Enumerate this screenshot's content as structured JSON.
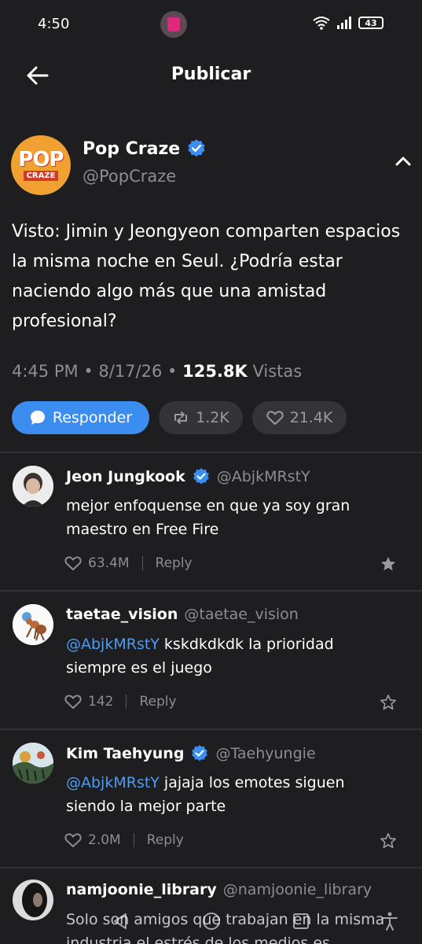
{
  "status": {
    "time": "4:50",
    "battery": "43"
  },
  "header": {
    "title": "Publicar"
  },
  "post": {
    "author": {
      "name": "Pop Craze",
      "handle": "@PopCraze",
      "logo_top": "POP",
      "logo_bottom": "CRAZE"
    },
    "text": "Visto: Jimin y Jeongyeon comparten espacios la misma noche en Seul. ¿Podría estar naciendo algo más que una amistad profesional?",
    "time": "4:45 PM",
    "date": "8/17/26",
    "views": "125.8K",
    "views_label": "Vistas",
    "reply_label": "Responder",
    "retweets": "1.2K",
    "likes": "21.4K"
  },
  "comments": [
    {
      "name": "Jeon Jungkook",
      "verified": true,
      "handle": "@AbjkMRstY",
      "mention": "",
      "text": "mejor enfoquense en que ya soy gran maestro en Free Fire",
      "likes": "63.4M",
      "reply_label": "Reply",
      "starred": true
    },
    {
      "name": "taetae_vision",
      "verified": false,
      "handle": "@taetae_vision",
      "mention": "@AbjkMRstY",
      "text": " kskdkdkdk la prioridad siempre es el juego",
      "likes": "142",
      "reply_label": "Reply",
      "starred": false
    },
    {
      "name": "Kim Taehyung",
      "verified": true,
      "handle": "@Taehyungie",
      "mention": "@AbjkMRstY",
      "text": " jajaja los emotes siguen siendo la mejor parte",
      "likes": "2.0M",
      "reply_label": "Reply",
      "starred": false
    },
    {
      "name": "namjoonie_library",
      "verified": false,
      "handle": "@namjoonie_library",
      "mention": "",
      "text": "Solo son amigos que trabajan en la misma industria el estrés de los medios es",
      "likes": "",
      "reply_label": "",
      "starred": false
    }
  ],
  "colors": {
    "accent": "#3b8df0",
    "background": "#1e1e20",
    "verified": "#3b8df0",
    "mention": "#4d9cf4"
  }
}
